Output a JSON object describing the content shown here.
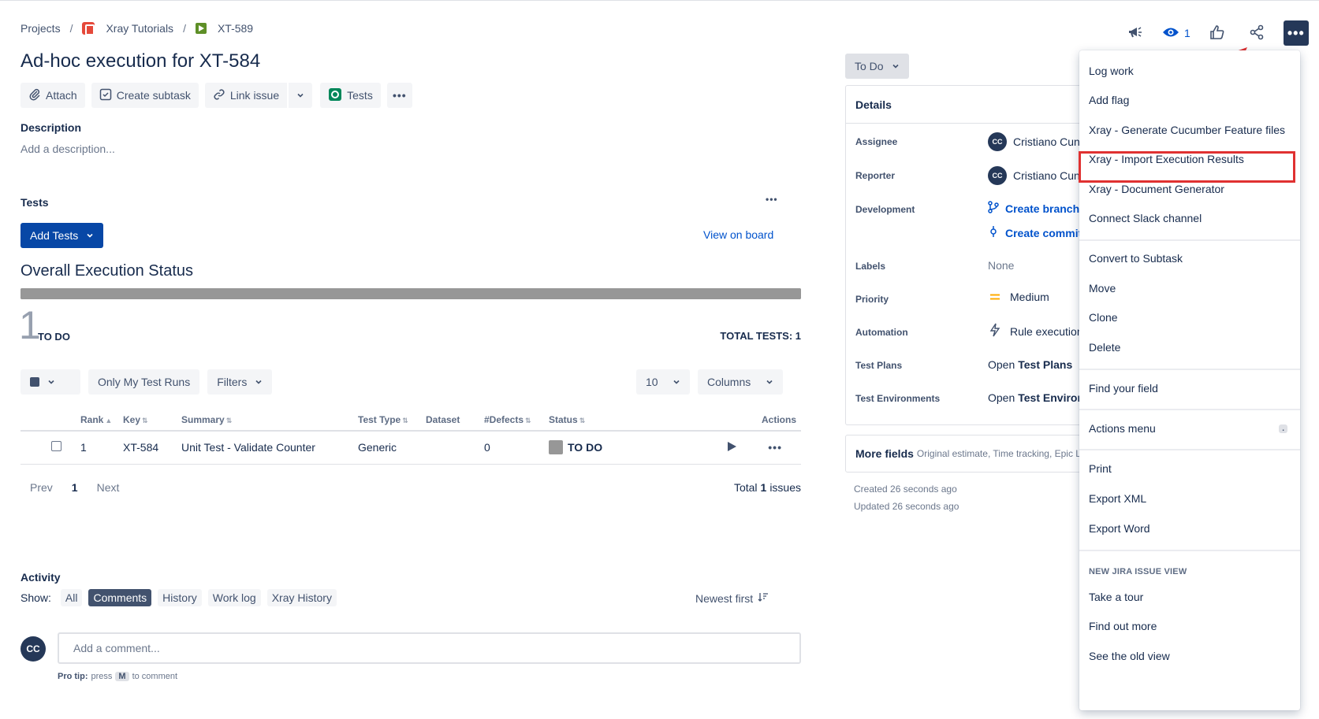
{
  "breadcrumb": {
    "projects": "Projects",
    "project": "Xray Tutorials",
    "issue": "XT-589"
  },
  "issue": {
    "title": "Ad-hoc execution for XT-584"
  },
  "toolbar": {
    "attach": "Attach",
    "create_subtask": "Create subtask",
    "link_issue": "Link issue",
    "tests": "Tests"
  },
  "description": {
    "label": "Description",
    "placeholder": "Add a description..."
  },
  "tests_section": {
    "label": "Tests",
    "add_tests": "Add Tests",
    "view_on_board": "View on board",
    "overall_status": "Overall Execution Status",
    "progress_todo_fraction": 1.0,
    "count": "1",
    "count_label": "TO DO",
    "total_tests": "TOTAL TESTS: 1",
    "only_my_runs": "Only My Test Runs",
    "filters": "Filters",
    "page_size": "10",
    "columns": "Columns",
    "headers": {
      "rank": "Rank",
      "key": "Key",
      "summary": "Summary",
      "test_type": "Test Type",
      "dataset": "Dataset",
      "defects": "#Defects",
      "status": "Status",
      "actions": "Actions"
    },
    "rows": [
      {
        "rank": "1",
        "key": "XT-584",
        "summary": "Unit Test - Validate Counter",
        "test_type": "Generic",
        "dataset": "",
        "defects": "0",
        "status": "TO DO"
      }
    ],
    "pager": {
      "prev": "Prev",
      "page": "1",
      "next": "Next",
      "total_prefix": "Total",
      "total_count": "1",
      "total_suffix": "issues"
    }
  },
  "activity": {
    "label": "Activity",
    "show": "Show:",
    "filters": [
      "All",
      "Comments",
      "History",
      "Work log",
      "Xray History"
    ],
    "selected": "Comments",
    "sort": "Newest first",
    "comment_placeholder": "Add a comment...",
    "avatar": "CC",
    "protip_label": "Pro tip:",
    "protip_press": "press",
    "protip_key": "M",
    "protip_rest": "to comment"
  },
  "header_icons": {
    "watch_count": "1"
  },
  "status_button": "To Do",
  "details": {
    "title": "Details",
    "assignee_label": "Assignee",
    "assignee": "Cristiano Cunha",
    "assignee_avatar": "CC",
    "reporter_label": "Reporter",
    "reporter": "Cristiano Cunha",
    "reporter_avatar": "CC",
    "development_label": "Development",
    "create_branch": "Create branch",
    "create_commit": "Create commit",
    "labels_label": "Labels",
    "labels": "None",
    "priority_label": "Priority",
    "priority": "Medium",
    "automation_label": "Automation",
    "automation": "Rule executions",
    "test_plans_label": "Test Plans",
    "test_plans_prefix": "Open",
    "test_plans_bold": "Test Plans",
    "test_env_label": "Test Environments",
    "test_env_prefix": "Open",
    "test_env_bold": "Test Environments"
  },
  "more_fields": {
    "label": "More fields",
    "hint": "Original estimate, Time tracking, Epic Link"
  },
  "timestamps": {
    "created": "Created 26 seconds ago",
    "updated": "Updated 26 seconds ago"
  },
  "menu": {
    "items_group1": [
      "Log work",
      "Add flag",
      "Xray - Generate Cucumber Feature files",
      "Xray - Import Execution Results",
      "Xray - Document Generator",
      "Connect Slack channel"
    ],
    "items_group2": [
      "Convert to Subtask",
      "Move",
      "Clone",
      "Delete"
    ],
    "find_field": "Find your field",
    "actions_menu": "Actions menu",
    "actions_shortcut": ".",
    "items_group3": [
      "Print",
      "Export XML",
      "Export Word"
    ],
    "new_view_heading": "NEW JIRA ISSUE VIEW",
    "items_group4": [
      "Take a tour",
      "Find out more",
      "See the old view"
    ],
    "highlighted": "Xray - Import Execution Results"
  },
  "colors": {
    "primary": "#0747A6",
    "link": "#0052CC",
    "highlight": "#E03131",
    "todo": "#979797",
    "priority_medium": "#FFAB00"
  }
}
